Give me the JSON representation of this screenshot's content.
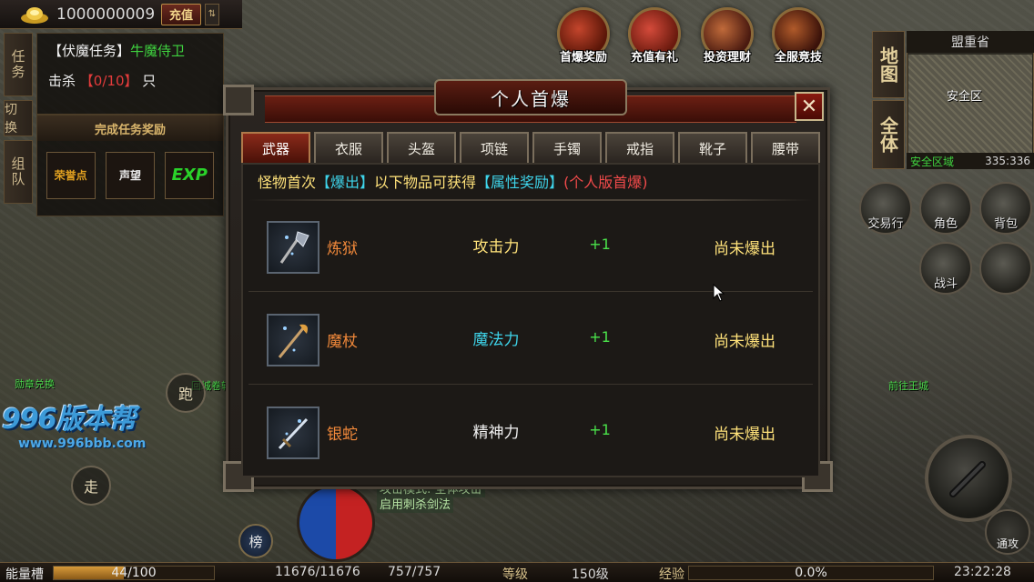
{
  "top_bar": {
    "gold_amount": "1000000009",
    "recharge_label": "充值",
    "collapse_label": "⇅"
  },
  "side_tabs": {
    "task": "任务",
    "switch": "切换",
    "team": "组队"
  },
  "quest": {
    "prefix": "【伏魔任务】",
    "target": "牛魔侍卫",
    "kill_label": "击杀",
    "progress": "【0/10】",
    "unit": "只"
  },
  "reward_panel": {
    "title": "完成任务奖励",
    "items": [
      {
        "label": "荣誉点",
        "color": "#e0a020"
      },
      {
        "label": "声望",
        "color": "#e8e8e8"
      },
      {
        "label": "EXP",
        "color": "#2ad22a"
      }
    ]
  },
  "features": [
    {
      "label": "首爆奖励"
    },
    {
      "label": "充值有礼"
    },
    {
      "label": "投资理财"
    },
    {
      "label": "全服竞技"
    }
  ],
  "minimap": {
    "tab_map": "地图",
    "tab_all": "全体",
    "location": "盟重省",
    "safe_label": "安全区",
    "zone_status": "安全区域",
    "coords": "335:336"
  },
  "right_buttons": {
    "trade": "交易行",
    "character": "角色",
    "bag": "背包",
    "battle": "战斗"
  },
  "npc_labels": {
    "left": "勋章兑换",
    "mid": "回城卷轴",
    "right": "前往王城"
  },
  "watermark": {
    "brand": "996版本帮",
    "url": "www.996bbb.com"
  },
  "controls": {
    "run": "跑",
    "walk": "走",
    "rank": "榜",
    "general_attack": "通攻"
  },
  "chat": {
    "line1": "攻击模式: 全体攻击",
    "line2": "启用刺杀剑法"
  },
  "status_bar": {
    "energy_label": "能量槽",
    "energy_value": "44/100",
    "energy_fraction": 0.44,
    "hp": "11676/11676",
    "mp": "757/757",
    "level_label": "等级",
    "level_value": "150级",
    "exp_label": "经验",
    "exp_value": "0.0%",
    "time": "23:22:28"
  },
  "modal": {
    "title": "个人首爆",
    "close_label": "✕",
    "tabs": [
      "武器",
      "衣服",
      "头盔",
      "项链",
      "手镯",
      "戒指",
      "靴子",
      "腰带"
    ],
    "active_tab": 0,
    "intro": {
      "part1": "怪物首次",
      "part2": "【爆出】",
      "part3": "以下物品可获得",
      "part4": "【属性奖励】",
      "part5": "(个人版首爆)"
    },
    "items": [
      {
        "name": "炼狱",
        "attr": "攻击力",
        "attr_color": "#ffe27a",
        "bonus": "+1",
        "status": "尚未爆出",
        "icon": "axe-icon"
      },
      {
        "name": "魔杖",
        "attr": "魔法力",
        "attr_color": "#3ed4ea",
        "bonus": "+1",
        "status": "尚未爆出",
        "icon": "staff-icon"
      },
      {
        "name": "银蛇",
        "attr": "精神力",
        "attr_color": "#f0f0f0",
        "bonus": "+1",
        "status": "尚未爆出",
        "icon": "sword-icon"
      }
    ]
  }
}
